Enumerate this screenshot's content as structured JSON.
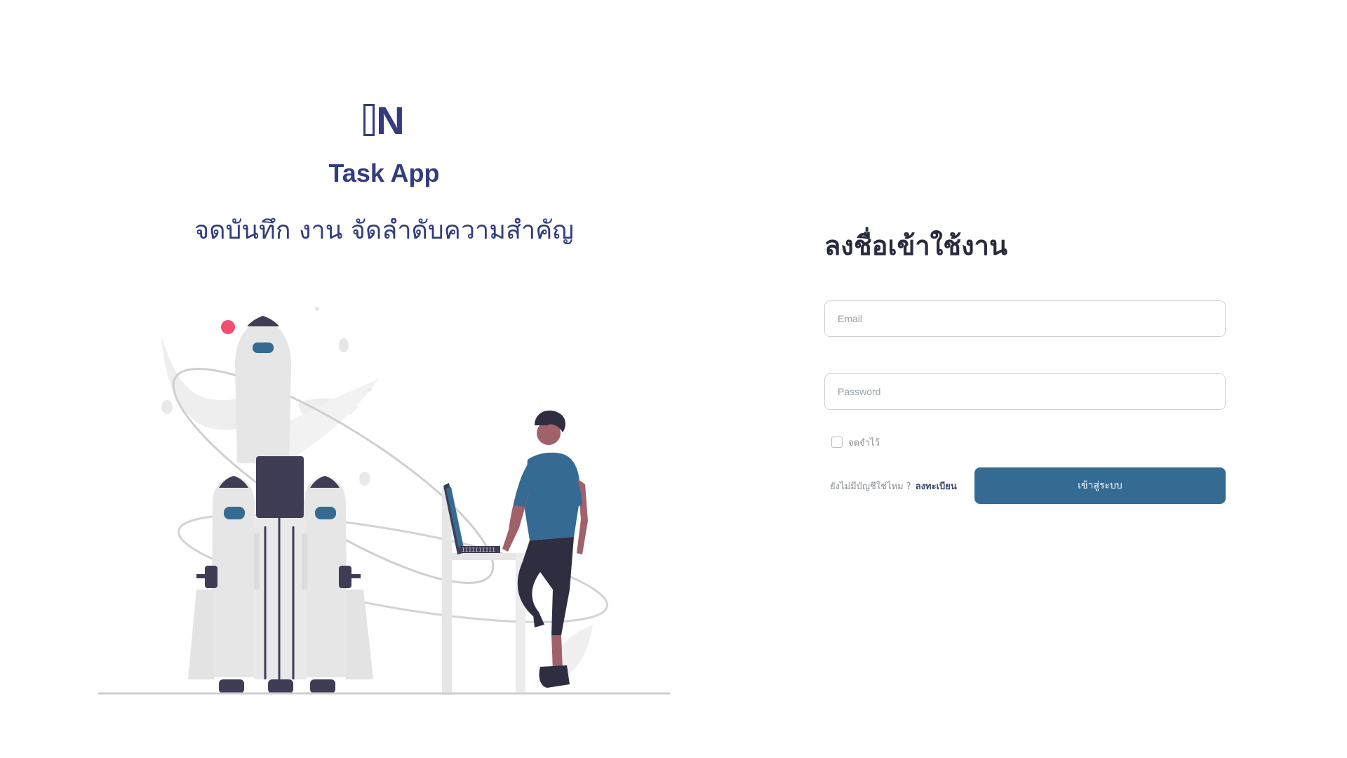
{
  "brand": {
    "logo_text": "N",
    "app_name": "Task App",
    "tagline": "จดบันทึก งาน จัดลำดับความสำคัญ"
  },
  "illustration": {
    "icon": "rocket-launch-person-laptop-illustration",
    "laptop_screen_text": "IIIIIIIIII"
  },
  "login": {
    "title": "ลงชื่อเข้าใช้งาน",
    "email_placeholder": "Email",
    "password_placeholder": "Password",
    "remember_label": "จดจำไว้",
    "no_account_text": "ยังไม่มีบัญชีใช่ไหม ?",
    "register_link": "ลงทะเบียน",
    "submit_label": "เข้าสู่ระบบ"
  },
  "colors": {
    "brand": "#323c7e",
    "button": "#356a92",
    "title": "#282a3e",
    "accent_pink": "#f0506e"
  }
}
